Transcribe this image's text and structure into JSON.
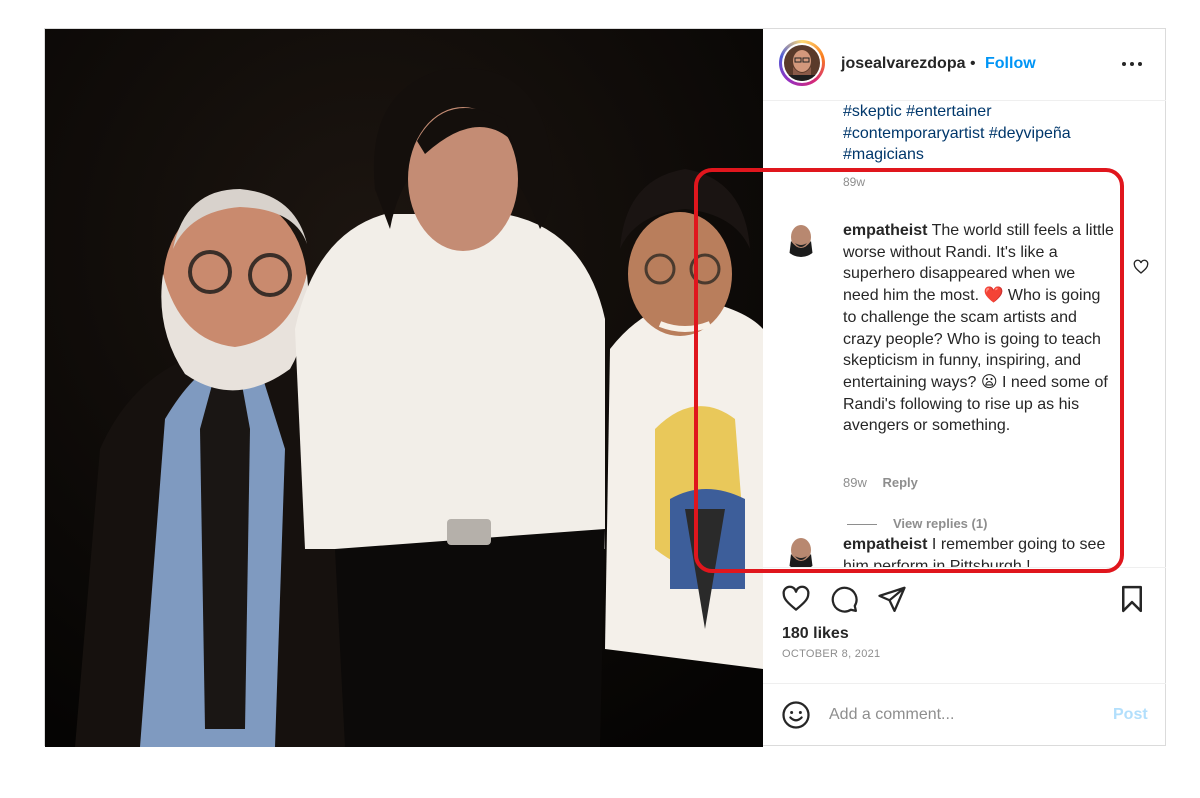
{
  "post": {
    "author": {
      "username": "josealvarezdopa",
      "separator": "•",
      "follow_label": "Follow",
      "more_icon": "more-horizontal-icon"
    },
    "caption": {
      "hashtags_lines": [
        "#skeptic #entertainer",
        "#contemporaryartist #deyvipeña",
        "#magicians"
      ],
      "age": "89w"
    },
    "comments": [
      {
        "username": "empatheist",
        "text_part1": "The world still feels a little worse without Randi. It's like a superhero disappeared when we need him the most.",
        "emoji1": "❤️",
        "text_part2": "Who is going to challenge the scam artists and crazy people? Who is going to teach skepticism in funny, inspiring, and entertaining ways?",
        "emoji2": "😦",
        "text_part3": "I need some of Randi's following to rise up as his avengers or something.",
        "age": "89w",
        "reply_label": "Reply",
        "view_replies_label": "View replies (1)"
      },
      {
        "username": "empatheist",
        "text": "I remember going to see him perform in Pittsburgh !"
      }
    ],
    "likes_text": "180 likes",
    "date_text": "OCTOBER 8, 2021",
    "add_comment": {
      "placeholder": "Add a comment...",
      "post_label": "Post"
    },
    "colors": {
      "link_blue": "#0095f6",
      "hashtag_blue": "#00376b",
      "annotation_red": "#e0161d",
      "muted_gray": "#8e8e8e",
      "post_disabled": "#b2dffc"
    }
  }
}
